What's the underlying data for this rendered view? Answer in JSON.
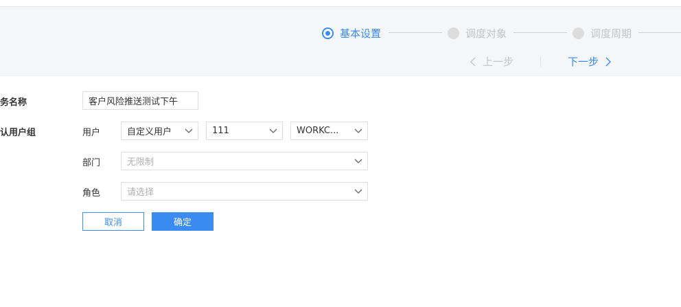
{
  "steps": [
    {
      "label": "基本设置",
      "state": "active"
    },
    {
      "label": "调度对象",
      "state": "inactive"
    },
    {
      "label": "调度周期",
      "state": "inactive"
    }
  ],
  "nav": {
    "prev_label": "上一步",
    "next_label": "下一步"
  },
  "form": {
    "task_name_label": "任务名称",
    "task_name_value": "客户风险推送测试下午",
    "group_label": "默认用户组",
    "user_label": "用户",
    "user_type_value": "自定义用户",
    "user_id_value": "111",
    "user_workc_value": "WORKC...",
    "dept_label": "部门",
    "dept_value": "无限制",
    "role_label": "角色",
    "role_placeholder": "请选择"
  },
  "buttons": {
    "cancel_label": "取消",
    "ok_label": "确定"
  },
  "colors": {
    "accent": "#3b8cf2",
    "header_bg": "#f5f6f8",
    "inactive": "#c4c4c4"
  }
}
